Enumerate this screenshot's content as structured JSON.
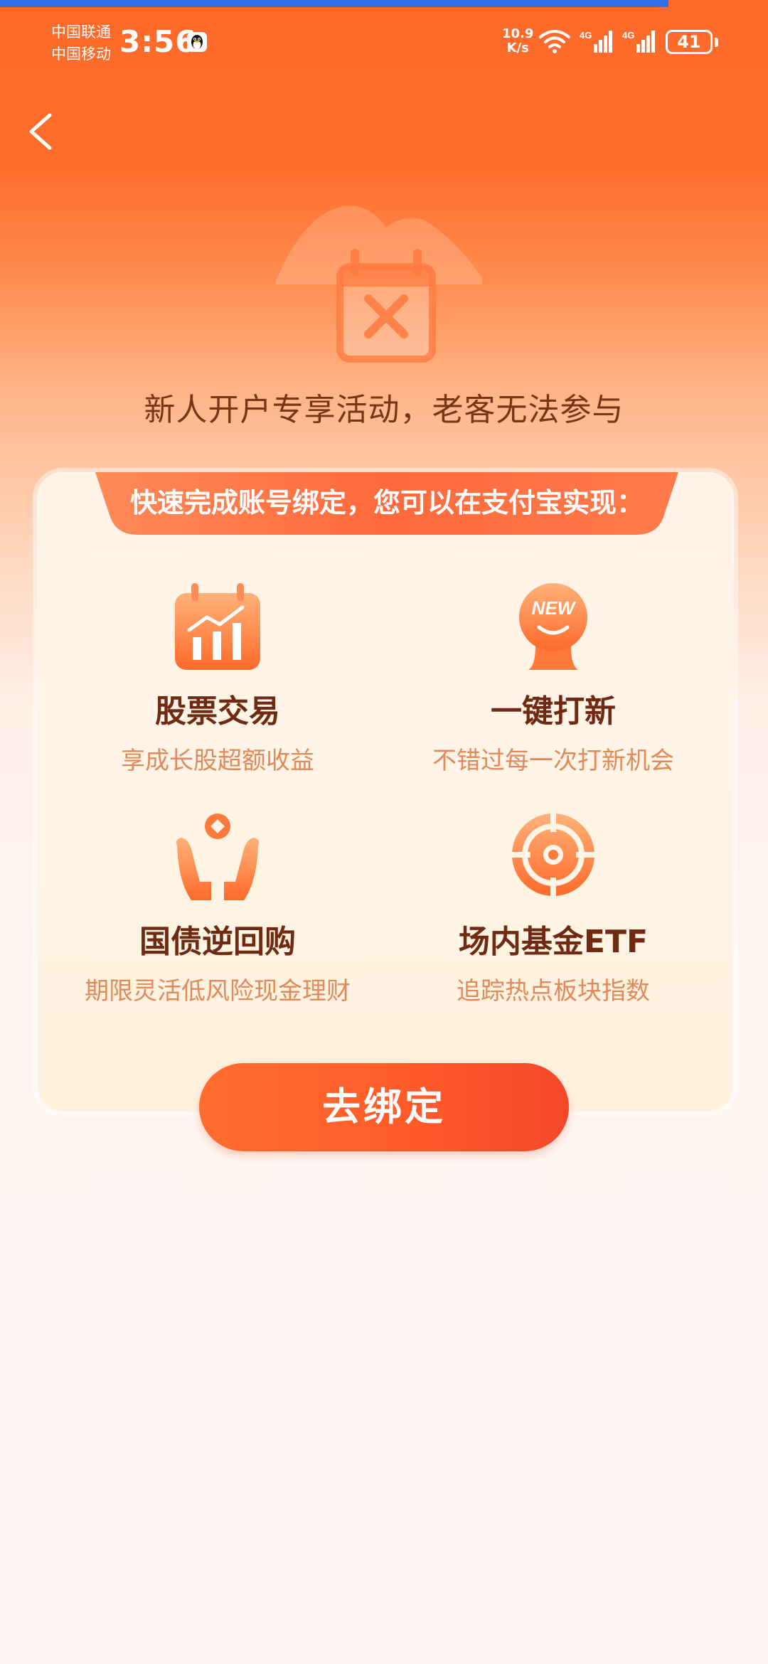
{
  "status_bar": {
    "carrier_1": "中国联通",
    "carrier_2": "中国移动",
    "time": "3:56",
    "net_speed_value": "10.9",
    "net_speed_unit": "K/s",
    "network_1": "4G",
    "network_2": "4G",
    "battery": "41"
  },
  "notice": {
    "text": "新人开户专享活动，老客无法参与"
  },
  "card": {
    "banner": "快速完成账号绑定，您可以在支付宝实现：",
    "features": [
      {
        "title": "股票交易",
        "subtitle": "享成长股超额收益",
        "icon": "stock-chart-icon"
      },
      {
        "title": "一键打新",
        "subtitle": "不错过每一次打新机会",
        "icon": "new-badge-icon",
        "badge": "NEW"
      },
      {
        "title": "国债逆回购",
        "subtitle": "期限灵活低风险现金理财",
        "icon": "hands-coin-icon"
      },
      {
        "title": "场内基金ETF",
        "subtitle": "追踪热点板块指数",
        "icon": "target-icon"
      }
    ]
  },
  "actions": {
    "bind_label": "去绑定"
  },
  "colors": {
    "primary_orange": "#ff6a2a",
    "title_brown": "#6e2a12",
    "subtitle_orange": "#e08a5c"
  }
}
